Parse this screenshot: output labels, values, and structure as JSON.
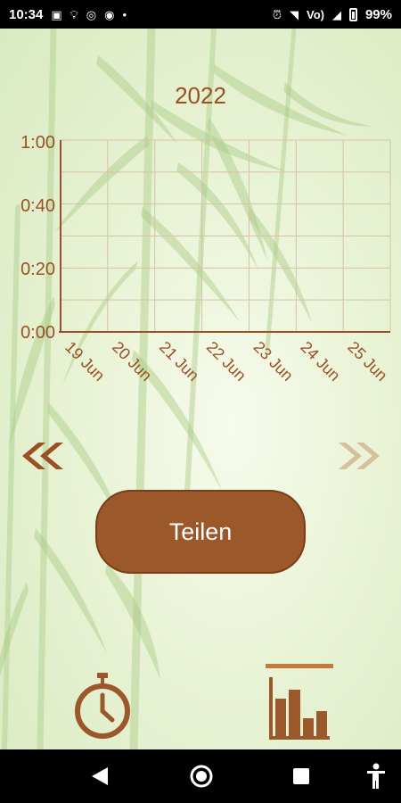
{
  "status_bar": {
    "time": "10:34",
    "network_label": "Vo)",
    "battery": "99%"
  },
  "year": "2022",
  "chart_data": {
    "type": "bar",
    "categories": [
      "19 Jun",
      "20 Jun",
      "21 Jun",
      "22 Jun",
      "23 Jun",
      "24 Jun",
      "25 Jun"
    ],
    "values": [
      0,
      0,
      0,
      0,
      0,
      0,
      0
    ],
    "y_tick_labels": [
      "1:00",
      "0:40",
      "0:20",
      "0:00"
    ],
    "ylim": [
      0,
      60
    ],
    "grid": true
  },
  "share_label": "Teilen",
  "icons": {
    "prev": "double-chevron-left-icon",
    "next": "double-chevron-right-icon",
    "timer": "stopwatch-icon",
    "stats": "bar-chart-icon"
  },
  "colors": {
    "accent": "#9b4f24",
    "button": "#9b582b",
    "inactive_arrow": "#d4c09c",
    "tab_indicator": "#c47a3d"
  }
}
